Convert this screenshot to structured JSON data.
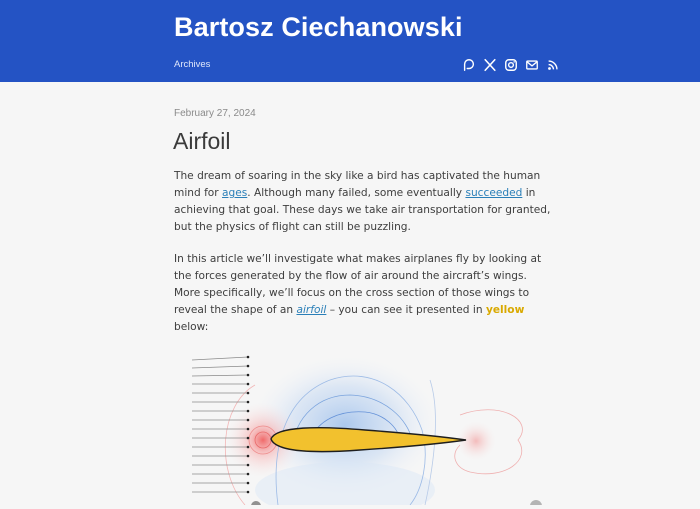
{
  "header": {
    "site_title": "Bartosz Ciechanowski",
    "nav_archives": "Archives",
    "social_icons": [
      "patreon-icon",
      "x-icon",
      "instagram-icon",
      "mail-icon",
      "rss-icon"
    ],
    "background_color": "#2453c4"
  },
  "article": {
    "date": "February 27, 2024",
    "title": "Airfoil",
    "p1": {
      "t1": "The dream of soaring in the sky like a bird has captivated the human mind for ",
      "link_ages": "ages",
      "t2": ". Although many failed, some eventually ",
      "link_succeeded": "succeeded",
      "t3": " in achieving that goal. These days we take air transportation for granted, but the physics of flight can still be puzzling."
    },
    "p2": {
      "t1": "In this article we’ll investigate what makes airplanes fly by looking at the forces generated by the flow of air around the aircraft’s wings. More specifically, we’ll focus on the cross section of those wings to reveal the shape of an ",
      "link_airfoil": "airfoil",
      "t2": " – you can see it presented in ",
      "yellow_word": "yellow",
      "t3": " below:"
    }
  },
  "colors": {
    "link": "#2a7fb8",
    "airfoil_fill": "#f2c12e",
    "highlight_yellow": "#d9a900"
  }
}
